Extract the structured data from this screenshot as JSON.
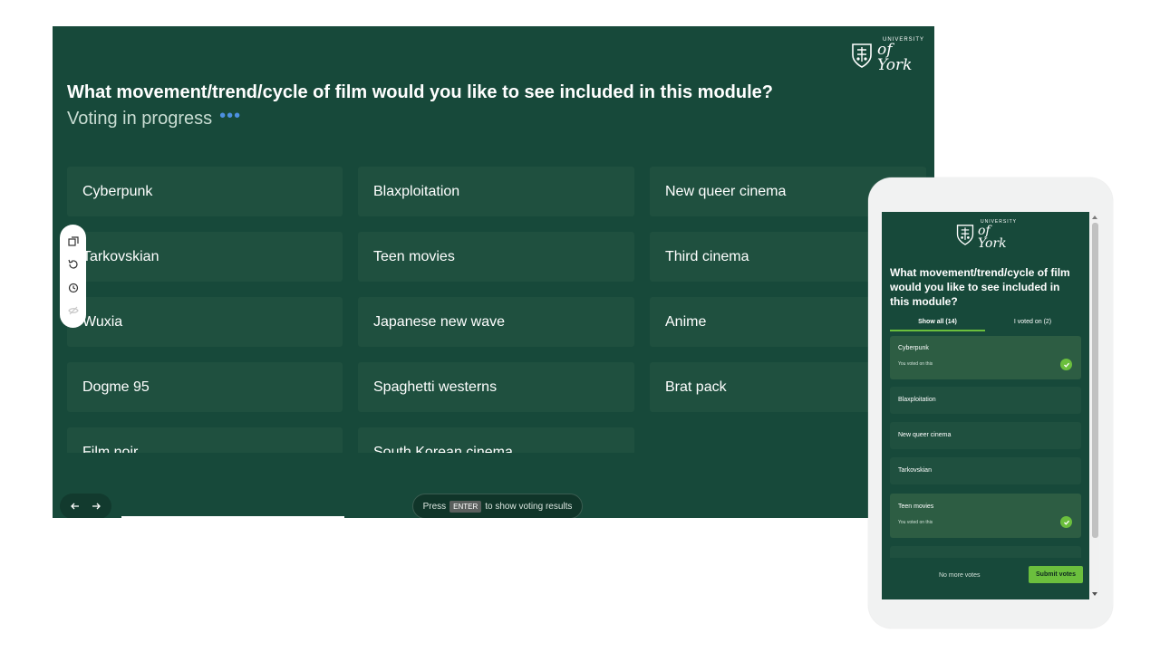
{
  "slide": {
    "logo": {
      "university": "UNIVERSITY",
      "york": "of York"
    },
    "question": "What movement/trend/cycle of film would you like to see included in this module?",
    "status": "Voting in progress",
    "status_dots": "•••",
    "options": [
      "Cyberpunk",
      "Blaxploitation",
      "New queer cinema",
      "Tarkovskian",
      "Teen movies",
      "Third cinema",
      "Wuxia",
      "Japanese new wave",
      "Anime",
      "Dogme 95",
      "Spaghetti westerns",
      "Brat pack",
      "Film noir",
      "South Korean cinema"
    ],
    "tools": [
      "duplicate-icon",
      "reset-icon",
      "timer-icon",
      "hide-icon"
    ],
    "nav": [
      "arrow-left-icon",
      "arrow-right-icon"
    ],
    "hint": {
      "press": "Press",
      "key": "ENTER",
      "suffix": "to show voting results"
    }
  },
  "phone": {
    "logo": {
      "university": "UNIVERSITY",
      "york": "of York"
    },
    "question": "What movement/trend/cycle of film would you like to see included in this module?",
    "tabs": [
      {
        "label": "Show all (14)",
        "active": true
      },
      {
        "label": "I voted on (2)",
        "active": false
      }
    ],
    "cards": [
      {
        "label": "Cyberpunk",
        "voted": true,
        "voted_text": "You voted on this"
      },
      {
        "label": "Blaxploitation",
        "voted": false
      },
      {
        "label": "New queer cinema",
        "voted": false
      },
      {
        "label": "Tarkovskian",
        "voted": false
      },
      {
        "label": "Teen movies",
        "voted": true,
        "voted_text": "You voted on this"
      }
    ],
    "no_more_votes": "No more votes",
    "submit_label": "Submit votes"
  },
  "colors": {
    "slide_bg": "#17493a",
    "option_bg": "#1f503f",
    "accent_green": "#6bbf3d",
    "dots_blue": "#4d90e0"
  }
}
